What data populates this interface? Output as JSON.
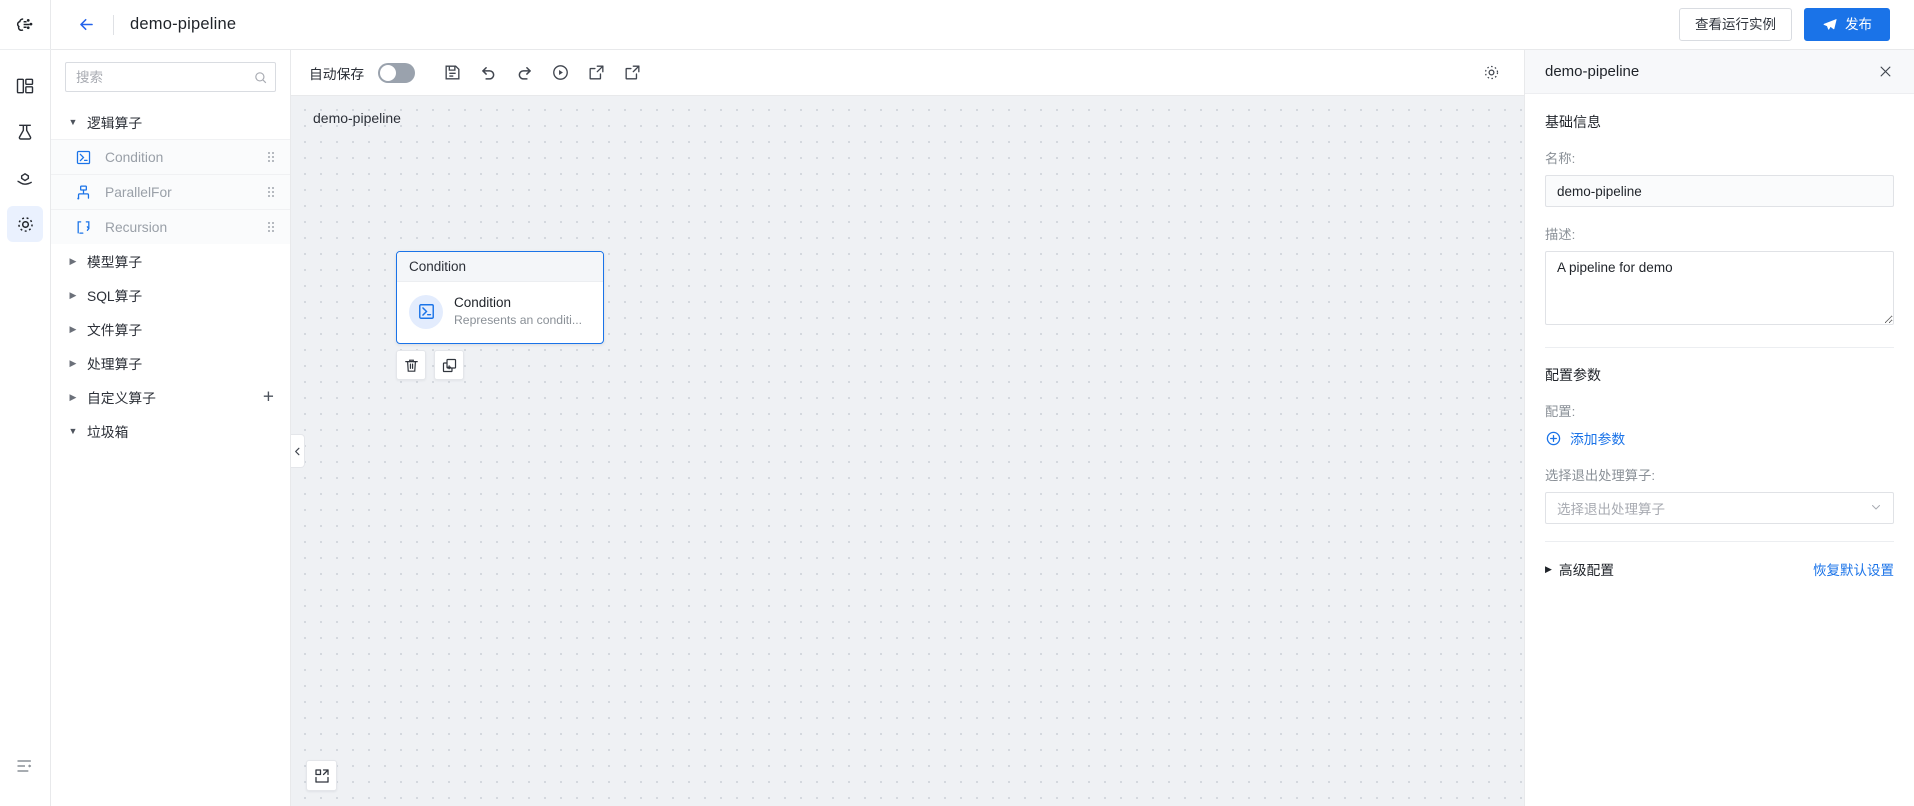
{
  "rail": {
    "logo_icon": "brain-logo-icon",
    "items": [
      {
        "icon": "dashboard-icon",
        "name": "dashboard",
        "active": false
      },
      {
        "icon": "experiment-flask-icon",
        "name": "experiment",
        "active": false
      },
      {
        "icon": "serving-hand-icon",
        "name": "serving",
        "active": false
      },
      {
        "icon": "settings-gear-icon",
        "name": "pipeline-settings",
        "active": true
      }
    ],
    "bottom_icon": "menu-expand-icon"
  },
  "header": {
    "back_icon": "arrow-left-icon",
    "title": "demo-pipeline",
    "view_runs_label": "查看运行实例",
    "publish_label": "发布",
    "publish_icon": "send-plane-icon"
  },
  "sidebar": {
    "search": {
      "placeholder": "搜索",
      "value": "",
      "icon": "search-icon"
    },
    "tree": [
      {
        "type": "group",
        "label": "逻辑算子",
        "expanded": true,
        "add": false
      },
      {
        "type": "leaf",
        "label": "Condition",
        "icon": "condition-icon"
      },
      {
        "type": "leaf",
        "label": "ParallelFor",
        "icon": "parallelfor-icon"
      },
      {
        "type": "leaf",
        "label": "Recursion",
        "icon": "recursion-icon"
      },
      {
        "type": "group",
        "label": "模型算子",
        "expanded": false,
        "add": false
      },
      {
        "type": "group",
        "label": "SQL算子",
        "expanded": false,
        "add": false
      },
      {
        "type": "group",
        "label": "文件算子",
        "expanded": false,
        "add": false
      },
      {
        "type": "group",
        "label": "处理算子",
        "expanded": false,
        "add": false
      },
      {
        "type": "group",
        "label": "自定义算子",
        "expanded": false,
        "add": true
      },
      {
        "type": "group",
        "label": "垃圾箱",
        "expanded": true,
        "add": false
      }
    ]
  },
  "toolbar": {
    "autosave_label": "自动保存",
    "autosave_on": false,
    "buttons": [
      {
        "name": "save-button",
        "icon": "save-icon"
      },
      {
        "name": "undo-button",
        "icon": "undo-icon"
      },
      {
        "name": "redo-button",
        "icon": "redo-icon"
      },
      {
        "name": "run-button",
        "icon": "play-circle-icon"
      },
      {
        "name": "export-button",
        "icon": "export-icon"
      },
      {
        "name": "import-button",
        "icon": "import-icon"
      }
    ],
    "settings_icon": "gear-icon"
  },
  "canvas": {
    "title": "demo-pipeline",
    "node": {
      "header": "Condition",
      "title": "Condition",
      "subtitle": "Represents an conditi...",
      "icon": "condition-icon"
    },
    "node_actions": [
      {
        "name": "delete-node-button",
        "icon": "trash-icon"
      },
      {
        "name": "duplicate-node-button",
        "icon": "copy-add-icon"
      }
    ],
    "fit_view_icon": "fit-view-icon",
    "collapse_icon": "chevron-left-icon"
  },
  "panel": {
    "title": "demo-pipeline",
    "close_icon": "close-icon",
    "basic_section": "基础信息",
    "name_label": "名称:",
    "name_value": "demo-pipeline",
    "desc_label": "描述:",
    "desc_value": "A pipeline for demo",
    "config_section": "配置参数",
    "config_label": "配置:",
    "add_param_label": "添加参数",
    "add_param_icon": "plus-circle-icon",
    "exit_op_label": "选择退出处理算子:",
    "exit_op_placeholder": "选择退出处理算子",
    "exit_op_caret": "chevron-down-icon",
    "advanced_label": "高级配置",
    "restore_default_label": "恢复默认设置"
  },
  "colors": {
    "accent": "#1a73e8",
    "canvas_bg": "#eff1f4",
    "panel_header_bg": "#f7f8fa"
  }
}
